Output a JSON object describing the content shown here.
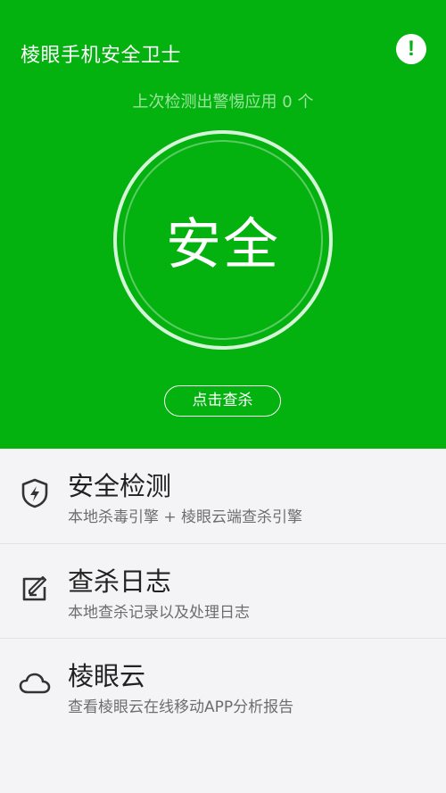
{
  "header": {
    "app_title": "棱眼手机安全卫士",
    "alert_icon": "exclamation-circle-icon",
    "last_scan_text": "上次检测出警惕应用 0 个",
    "status_text": "安全",
    "scan_button_label": "点击查杀"
  },
  "menu": {
    "items": [
      {
        "icon": "shield-lightning-icon",
        "title": "安全检测",
        "subtitle": "本地杀毒引擎 + 棱眼云端查杀引擎"
      },
      {
        "icon": "log-edit-icon",
        "title": "查杀日志",
        "subtitle": "本地查杀记录以及处理日志"
      },
      {
        "icon": "cloud-icon",
        "title": "棱眼云",
        "subtitle": "查看棱眼云在线移动APP分析报告"
      }
    ]
  },
  "colors": {
    "brand_green": "#03b10f",
    "background": "#f4f4f6",
    "title_text": "#222222",
    "subtitle_text": "#6d6d6d"
  }
}
